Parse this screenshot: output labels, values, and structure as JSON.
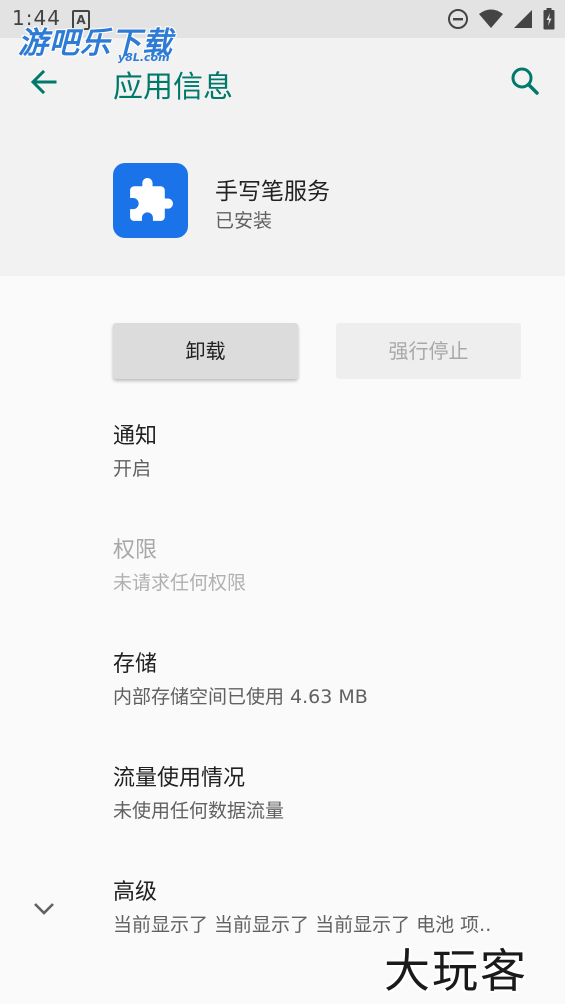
{
  "status_bar": {
    "time": "1:44",
    "notification_letter": "A",
    "icons": [
      "dnd-icon",
      "wifi-icon",
      "signal-icon",
      "battery-icon"
    ]
  },
  "watermark_top": {
    "text": "游吧乐下载",
    "subtext": "y8L.com"
  },
  "toolbar": {
    "title": "应用信息",
    "accent_color": "#00796b"
  },
  "app": {
    "name": "手写笔服务",
    "status": "已安装",
    "icon": "puzzle-icon",
    "icon_color": "#1a73e8"
  },
  "buttons": {
    "uninstall": "卸载",
    "force_stop": "强行停止"
  },
  "prefs": [
    {
      "title": "通知",
      "summary": "开启",
      "enabled": true
    },
    {
      "title": "权限",
      "summary": "未请求任何权限",
      "enabled": false
    },
    {
      "title": "存储",
      "summary": "内部存储空间已使用 4.63 MB",
      "enabled": true
    },
    {
      "title": "流量使用情况",
      "summary": "未使用任何数据流量",
      "enabled": true
    },
    {
      "title": "高级",
      "summary": "当前显示了 当前显示了 当前显示了 电池 项..",
      "enabled": true
    }
  ],
  "watermark_bottom": {
    "text": "大玩客"
  }
}
